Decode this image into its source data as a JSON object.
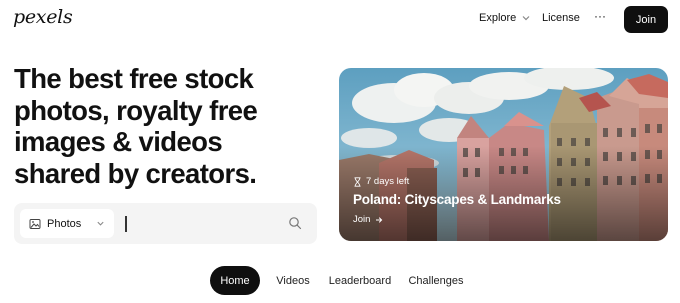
{
  "header": {
    "logo": "pexels",
    "nav": {
      "explore_label": "Explore",
      "license_label": "License",
      "more_label": "···",
      "join_label": "Join"
    }
  },
  "hero_text": {
    "headline": "The best free stock photos, royalty free images & videos shared by creators."
  },
  "search": {
    "type_label": "Photos",
    "query": "",
    "placeholder": ""
  },
  "featured": {
    "meta": "7 days left",
    "title": "Poland: Cityscapes & Landmarks",
    "join_label": "Join"
  },
  "tabs": [
    {
      "label": "Home",
      "active": true
    },
    {
      "label": "Videos",
      "active": false
    },
    {
      "label": "Leaderboard",
      "active": false
    },
    {
      "label": "Challenges",
      "active": false
    }
  ],
  "icons": {
    "explore_chevron": "chevron-down-icon",
    "photos_type": "image-icon",
    "photos_chevron": "chevron-down-icon",
    "search": "search-icon",
    "meta": "hourglass-icon",
    "join_arrow": "arrow-right-icon"
  }
}
